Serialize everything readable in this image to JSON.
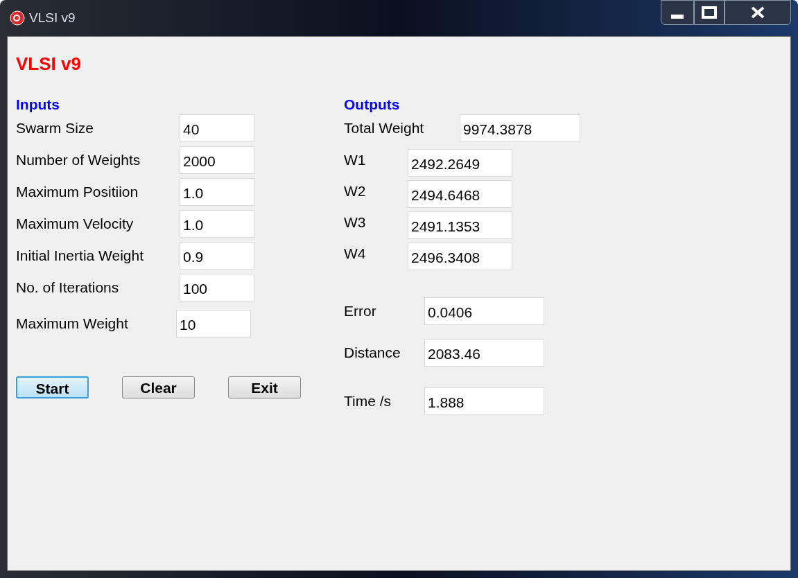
{
  "window": {
    "title": "VLSI v9"
  },
  "app_title": "VLSI v9",
  "inputs": {
    "heading": "Inputs",
    "fields": [
      {
        "label": "Swarm Size",
        "value": "40"
      },
      {
        "label": "Number of Weights",
        "value": "2000"
      },
      {
        "label": "Maximum Positiion",
        "value": "1.0"
      },
      {
        "label": "Maximum Velocity",
        "value": "1.0"
      },
      {
        "label": "Initial Inertia Weight",
        "value": "0.9"
      },
      {
        "label": "No. of Iterations",
        "value": "100"
      },
      {
        "label": "Maximum Weight",
        "value": "10"
      }
    ]
  },
  "buttons": [
    {
      "label": "Start",
      "focused": true
    },
    {
      "label": "Clear",
      "focused": false
    },
    {
      "label": "Exit",
      "focused": false
    }
  ],
  "outputs": {
    "heading": "Outputs",
    "total": {
      "label": "Total Weight",
      "value": "9974.3878"
    },
    "weights": [
      {
        "label": "W1",
        "value": "2492.2649"
      },
      {
        "label": "W2",
        "value": "2494.6468"
      },
      {
        "label": "W3",
        "value": "2491.1353"
      },
      {
        "label": "W4",
        "value": "2496.3408"
      }
    ],
    "results": [
      {
        "label": "Error",
        "value": "0.0406"
      },
      {
        "label": "Distance",
        "value": "2083.46"
      },
      {
        "label": "Time /s",
        "value": "1.888"
      }
    ]
  }
}
